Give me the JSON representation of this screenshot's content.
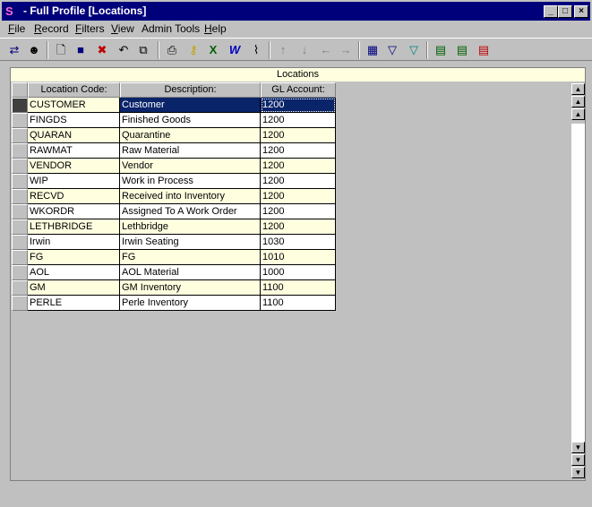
{
  "window": {
    "title": "- Full Profile [Locations]"
  },
  "menu": [
    {
      "label": "File",
      "accel": "F",
      "rest": "ile"
    },
    {
      "label": "Record",
      "accel": "R",
      "rest": "ecord"
    },
    {
      "label": "Filters",
      "accel": "F",
      "rest": "ilters"
    },
    {
      "label": "View",
      "accel": "V",
      "rest": "iew"
    },
    {
      "label": "Admin Tools",
      "accel": "",
      "rest": "Admin Tools"
    },
    {
      "label": "Help",
      "accel": "H",
      "rest": "elp"
    }
  ],
  "toolbar_icons": [
    "nav-icon",
    "profile-icon",
    "new-document-icon",
    "save-icon",
    "delete-icon",
    "undo-icon",
    "copy-icon",
    "print-icon",
    "key-icon",
    "excel-icon",
    "word-icon",
    "attach-icon",
    "arrow-up-icon",
    "arrow-down-icon",
    "arrow-left-icon",
    "arrow-right-icon",
    "calculator-icon",
    "filter-icon",
    "filter-clear-icon",
    "report-icon",
    "report-edit-icon",
    "report-delete-icon"
  ],
  "panel": {
    "title": "Locations"
  },
  "table": {
    "columns": [
      "Location Code:",
      "Description:",
      "GL Account:"
    ],
    "rows": [
      [
        "CUSTOMER",
        "Customer",
        "1200"
      ],
      [
        "FINGDS",
        "Finished Goods",
        "1200"
      ],
      [
        "QUARAN",
        "Quarantine",
        "1200"
      ],
      [
        "RAWMAT",
        "Raw Material",
        "1200"
      ],
      [
        "VENDOR",
        "Vendor",
        "1200"
      ],
      [
        "WIP",
        "Work in Process",
        "1200"
      ],
      [
        "RECVD",
        "Received into Inventory",
        "1200"
      ],
      [
        "WKORDR",
        "Assigned To A Work Order",
        "1200"
      ],
      [
        "LETHBRIDGE",
        "Lethbridge",
        "1200"
      ],
      [
        "Irwin",
        "Irwin Seating",
        "1030"
      ],
      [
        "FG",
        "FG",
        "1010"
      ],
      [
        "AOL",
        "AOL Material",
        "1000"
      ],
      [
        "GM",
        "GM Inventory",
        "1100"
      ],
      [
        "PERLE",
        "Perle Inventory",
        "1100"
      ]
    ],
    "selected_row": 0,
    "colors": {
      "odd_row": "#ffffe0",
      "even_row": "#ffffff",
      "selected": "#0a246a"
    }
  }
}
